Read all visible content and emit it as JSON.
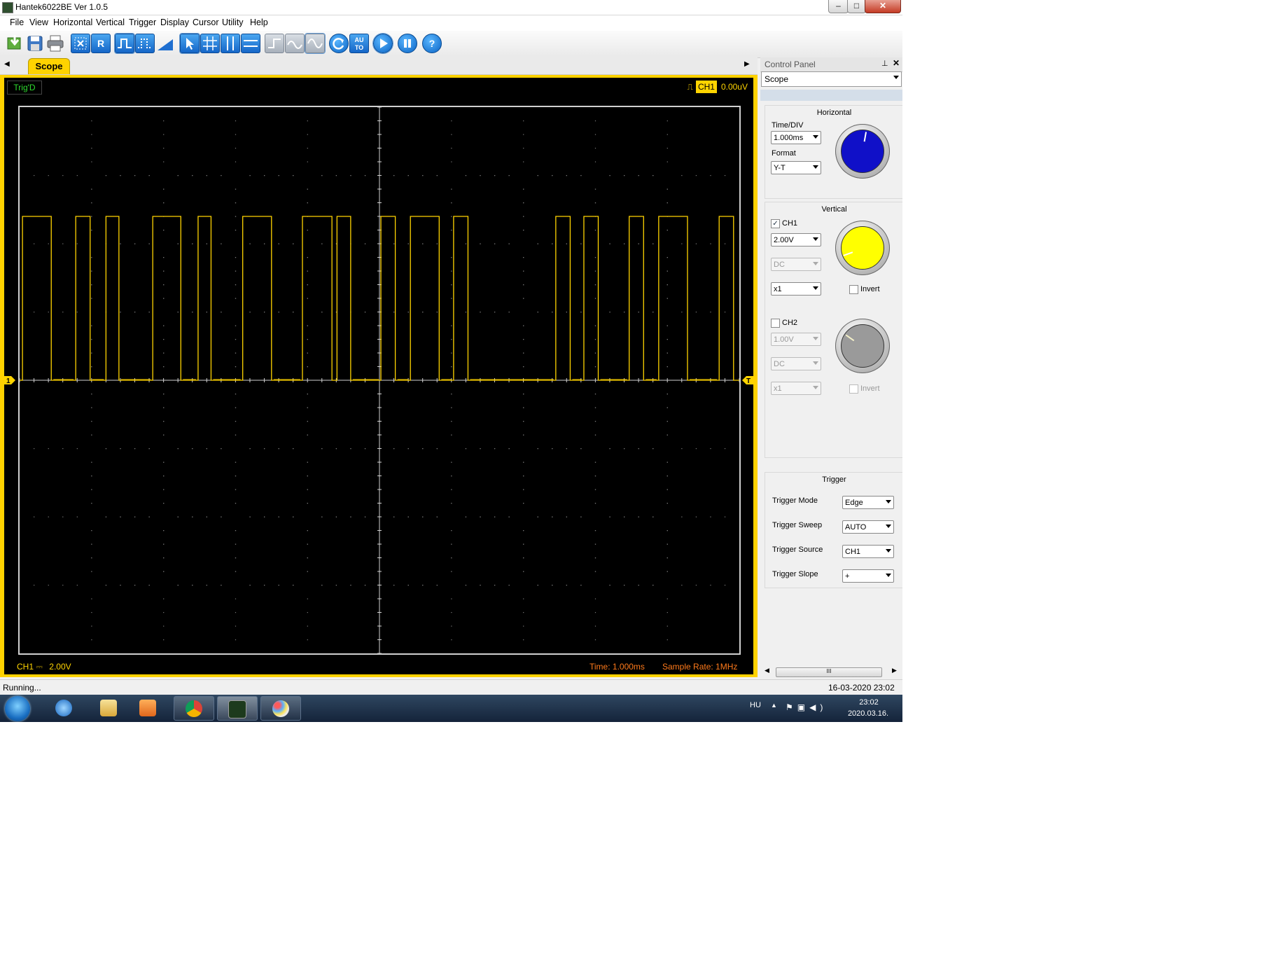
{
  "window": {
    "title": "Hantek6022BE Ver 1.0.5",
    "min": "–",
    "max": "□",
    "close": "✕"
  },
  "menu": [
    "File",
    "View",
    "Horizontal",
    "Vertical",
    "Trigger",
    "Display",
    "Cursor",
    "Utility",
    "Help"
  ],
  "toolbar": {
    "icons": [
      "open-icon",
      "save-icon",
      "print-icon",
      "autoset-icon",
      "reference-icon",
      "square-wave-icon",
      "dotted-wave-icon",
      "ramp-icon",
      "cursor-select-icon",
      "cursor-cross-icon",
      "cursor-vertical-icon",
      "cursor-horizontal-icon",
      "step-icon",
      "wave-icon",
      "sine-icon",
      "refresh-icon",
      "auto-icon",
      "run-icon",
      "pause-icon",
      "help-icon"
    ],
    "r_label": "R",
    "auto_label": "AU TO",
    "help_label": "?"
  },
  "scope_tab": {
    "label": "Scope"
  },
  "scope": {
    "trig_status": "Trig'D",
    "trig_channel": "CH1",
    "trig_level": "0.00uV",
    "ch1_marker": "1",
    "trig_marker": "T",
    "status_ch1": "CH1",
    "status_ch1_coupling": "⎓",
    "status_ch1_scale": "2.00V",
    "status_time": "Time: 1.000ms",
    "status_rate": "Sample Rate: 1MHz",
    "colors": {
      "trace": "#ffd400",
      "grid": "#cfcfcf",
      "frame": "#ffd200"
    }
  },
  "control_panel": {
    "title": "Control Panel",
    "selector": "Scope",
    "horizontal": {
      "title": "Horizontal",
      "timediv_label": "Time/DIV",
      "timediv": "1.000ms",
      "format_label": "Format",
      "format": "Y-T",
      "knob_color": "#1010c8"
    },
    "vertical": {
      "title": "Vertical",
      "ch1": {
        "label": "CH1",
        "checked": true,
        "volts": "2.00V",
        "coupling": "DC",
        "probe": "x1",
        "invert": "Invert",
        "knob_color": "#ffff00"
      },
      "ch2": {
        "label": "CH2",
        "checked": false,
        "volts": "1.00V",
        "coupling": "DC",
        "probe": "x1",
        "invert": "Invert",
        "knob_color": "#9a9a9a"
      }
    },
    "trigger": {
      "title": "Trigger",
      "rows": [
        {
          "label": "Trigger Mode",
          "value": "Edge"
        },
        {
          "label": "Trigger Sweep",
          "value": "AUTO"
        },
        {
          "label": "Trigger Source",
          "value": "CH1"
        },
        {
          "label": "Trigger Slope",
          "value": "+"
        }
      ]
    },
    "scroll_thumb": "III"
  },
  "status_bar": {
    "left": "Running...",
    "right": "16-03-2020  23:02"
  },
  "taskbar": {
    "apps": [
      "internet-explorer-icon",
      "file-explorer-icon",
      "media-player-icon",
      "chrome-icon",
      "oscilloscope-app-icon",
      "paint-icon"
    ],
    "lang": "HU",
    "time": "23:02",
    "date": "2020.03.16."
  },
  "chart_data": {
    "type": "line",
    "title": "",
    "xlabel": "",
    "ylabel": "",
    "x_unit": "ms",
    "x_per_div": 1.0,
    "x_divisions": 10,
    "y_unit": "V",
    "y_per_div": 2.0,
    "y_divisions": 8,
    "xlim": [
      -5,
      5
    ],
    "ylim": [
      -8,
      8
    ],
    "series": [
      {
        "name": "CH1",
        "high_volts": 4.8,
        "low_volts": 0,
        "high_intervals_ms": [
          [
            -4.96,
            -4.56
          ],
          [
            -4.22,
            -4.02
          ],
          [
            -3.8,
            -3.62
          ],
          [
            -3.15,
            -2.76
          ],
          [
            -2.52,
            -2.34
          ],
          [
            -1.9,
            -1.5
          ],
          [
            -1.07,
            -0.66
          ],
          [
            -0.59,
            -0.4
          ],
          [
            0.02,
            0.22
          ],
          [
            0.43,
            0.83
          ],
          [
            1.03,
            1.23
          ],
          [
            2.45,
            2.65
          ],
          [
            2.84,
            3.04
          ],
          [
            3.47,
            3.67
          ],
          [
            3.88,
            4.28
          ],
          [
            4.72,
            4.92
          ]
        ]
      }
    ]
  }
}
